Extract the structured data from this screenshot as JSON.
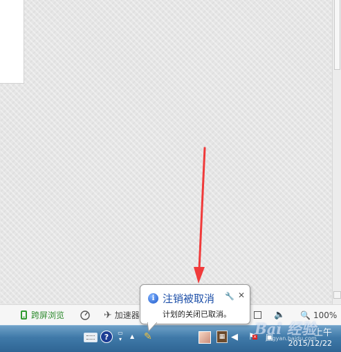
{
  "statusbar": {
    "cross_screen_label": "跨屏浏览",
    "accelerator_label": "加速器",
    "zoom_label": "100%"
  },
  "balloon": {
    "title": "注销被取消",
    "message": "计划的关闭已取消。",
    "info_symbol": "i"
  },
  "taskbar": {
    "help_symbol": "?",
    "clock_time": "上午",
    "clock_date": "2015/12/22"
  },
  "watermark": {
    "text": "Bai 经验",
    "url": "jingyan.baidu.com"
  },
  "colors": {
    "arrow": "#f03a3a",
    "balloon_title": "#1d4fa8",
    "cross_screen": "#2e8b2e",
    "taskbar": "#3f79a8"
  },
  "icons": [
    "document-page",
    "red-arrow",
    "phone-icon",
    "gauge-icon",
    "rocket-icon",
    "view-icon",
    "speaker-icon",
    "zoom-icon",
    "info-icon",
    "wrench-icon",
    "close-icon",
    "keyboard-icon",
    "help-icon",
    "restore-icon",
    "tray-up-icon",
    "tray-app-icon",
    "picture-icon",
    "network-icon",
    "volume-icon",
    "action-center-icon"
  ]
}
